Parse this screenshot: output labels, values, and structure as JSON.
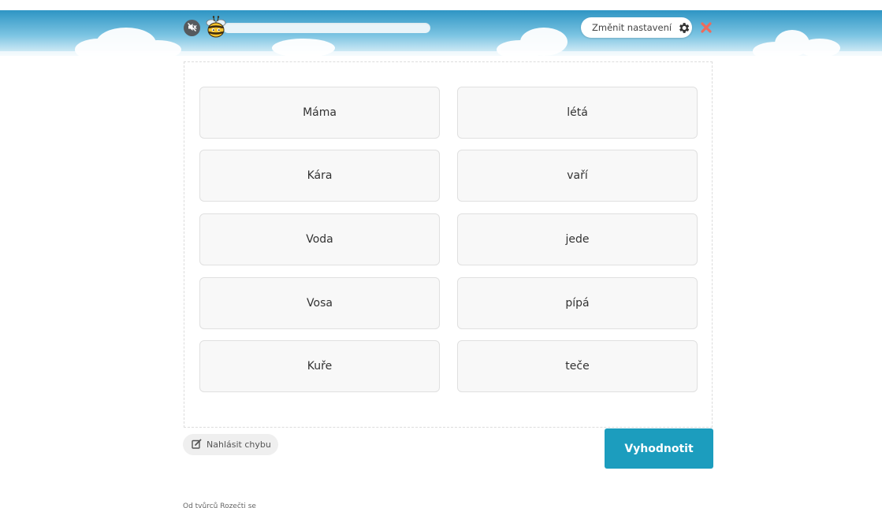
{
  "header": {
    "sound_icon": "sound-off-icon",
    "mascot_icon": "bee-icon",
    "progress": 0.0,
    "settings_label": "Změnit nastavení",
    "settings_icon": "gear-icon",
    "close_icon": "close-icon",
    "accent_color": "#27a1c4",
    "close_color": "#ef6b5b"
  },
  "exercise": {
    "left_column": [
      "Máma",
      "Kára",
      "Voda",
      "Vosa",
      "Kuře"
    ],
    "right_column": [
      "létá",
      "vaří",
      "jede",
      "pípá",
      "teče"
    ]
  },
  "footer": {
    "report_label": "Nahlásit chybu",
    "report_icon": "edit-icon",
    "evaluate_label": "Vyhodnotit",
    "evaluate_color": "#1c9dbe",
    "credit_text": "Od tvůrců Rozečti se"
  }
}
